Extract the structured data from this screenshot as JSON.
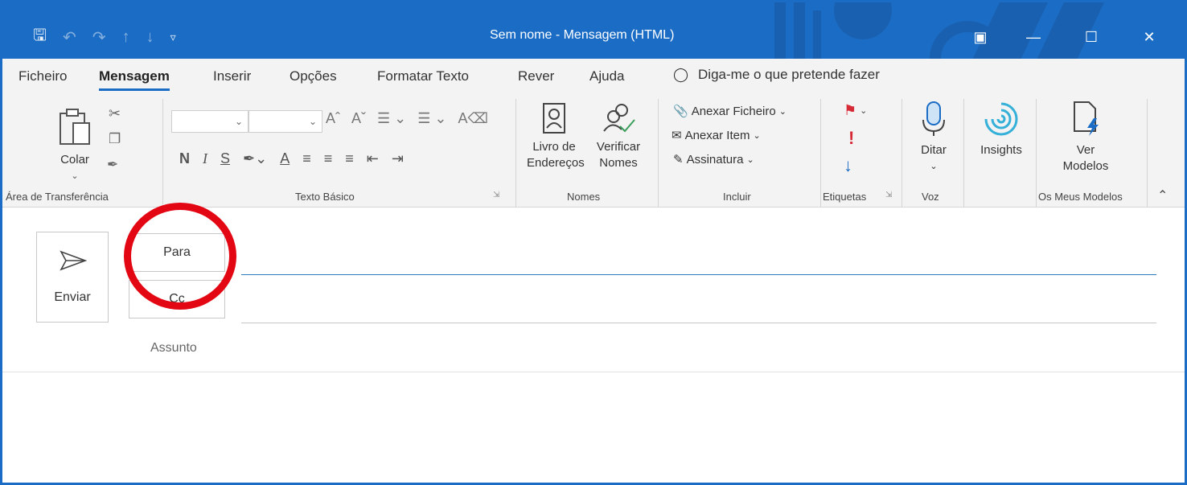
{
  "window": {
    "title": "Sem nome  -  Mensagem (HTML)",
    "accent": "#1b6cc4"
  },
  "tabs": [
    "Ficheiro",
    "Mensagem",
    "Inserir",
    "Opções",
    "Formatar Texto",
    "Rever",
    "Ajuda"
  ],
  "active_tab": "Mensagem",
  "tell_me": "Diga-me o que pretende fazer",
  "ribbon": {
    "clipboard": {
      "paste": "Colar",
      "group": "Área de Transferência"
    },
    "basic_text": {
      "group": "Texto Básico",
      "bold": "N",
      "italic": "I",
      "underline": "S"
    },
    "names": {
      "address_book_l1": "Livro de",
      "address_book_l2": "Endereços",
      "check_names_l1": "Verificar",
      "check_names_l2": "Nomes",
      "group": "Nomes"
    },
    "include": {
      "attach_file": "Anexar Ficheiro",
      "attach_item": "Anexar Item",
      "signature": "Assinatura",
      "group": "Incluir"
    },
    "tags": {
      "group": "Etiquetas"
    },
    "voice": {
      "dictate": "Ditar",
      "group": "Voz"
    },
    "insights": {
      "label": "Insights"
    },
    "templates": {
      "view_l1": "Ver",
      "view_l2": "Modelos",
      "group": "Os Meus Modelos"
    }
  },
  "compose": {
    "send": "Enviar",
    "to": "Para",
    "cc": "Cc",
    "subject": "Assunto"
  },
  "annotation_color": "#e30613"
}
